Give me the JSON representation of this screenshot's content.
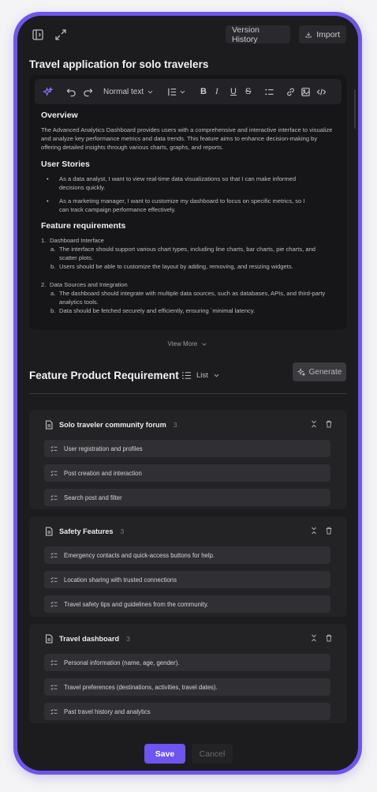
{
  "topbar": {
    "version_history": "Version History",
    "import": "Import"
  },
  "doc": {
    "title": "Travel application for solo travelers"
  },
  "toolbar": {
    "text_style": "Normal text"
  },
  "content": {
    "overview_heading": "Overview",
    "overview_text": "The Advanced Analytics Dashboard provides users with a comprehensive and interactive interface to visualize and analyze key performance metrics and data trends. This feature aims to enhance decision-making by offering detailed insights through various charts, graphs, and reports.",
    "stories_heading": "User Stories",
    "stories": [
      "As a data analyst, I want to view real-time data visualizations so that I can make informed decisions quickly.",
      "As a marketing manager, I want to customize my dashboard to focus on specific metrics, so I can track campaign performance effectively."
    ],
    "requirements_heading": "Feature requirements",
    "requirements": [
      {
        "num": "1.",
        "title": "Dashboard Interface",
        "items": [
          {
            "letter": "a.",
            "text": "The interface should support various chart types, including line charts, bar charts, pie charts, and scatter plots."
          },
          {
            "letter": "b.",
            "text": "Users should be able to customize the layout by adding, removing, and resizing widgets."
          }
        ]
      },
      {
        "num": "2.",
        "title": "Data Sources and Integration",
        "items": [
          {
            "letter": "a.",
            "text": "The dashboard should integrate with multiple data sources, such as databases, APIs, and third-party analytics tools."
          },
          {
            "letter": "b.",
            "text": "Data should be fetched securely and efficiently, ensuring `minimal latency."
          }
        ]
      }
    ]
  },
  "view_more": "View More",
  "fpr": {
    "title": "Feature Product Requirement",
    "view_mode": "List",
    "generate": "Generate"
  },
  "sections": [
    {
      "title": "Solo traveler community forum",
      "count": "3",
      "items": [
        "User registration and profiles",
        "Post creation and interaction",
        "Search post and filter"
      ]
    },
    {
      "title": "Safety Features",
      "count": "3",
      "items": [
        "Emergency contacts and quick-access buttons for help.",
        "Location sharing with trusted connections",
        "Travel safety tips and guidelines from the community."
      ]
    },
    {
      "title": "Travel dashboard",
      "count": "3",
      "items": [
        "Personal information (name, age, gender).",
        "Travel preferences (destinations, activities, travel dates).",
        "Past travel history and analytics"
      ]
    }
  ],
  "actions": {
    "save": "Save",
    "cancel": "Cancel"
  },
  "colors": {
    "accent": "#6e55ef",
    "frame": "#6f55ee",
    "background": "#1c1c1f"
  }
}
